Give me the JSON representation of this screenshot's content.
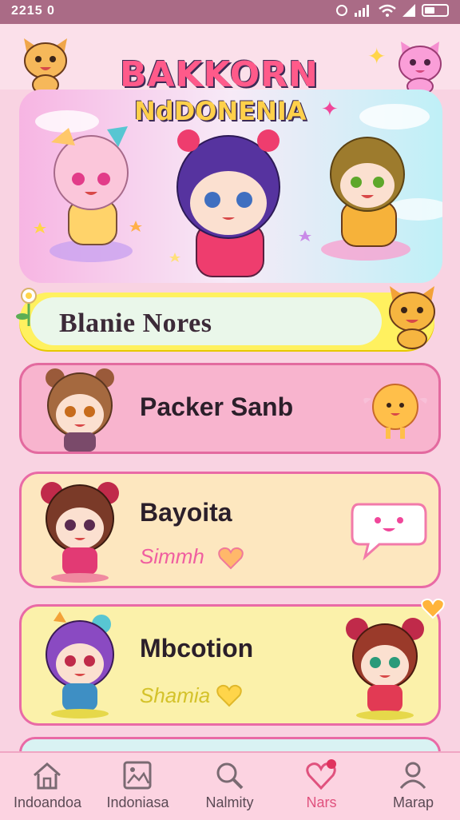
{
  "status_bar": {
    "time": "2215 0"
  },
  "header": {
    "logo_line1": "BAKKORN",
    "logo_line2": "NdDONENIA"
  },
  "banner": {
    "label": "Blanie Nores"
  },
  "cards": [
    {
      "title": "Packer Sanb",
      "subtitle": ""
    },
    {
      "title": "Bayoita",
      "subtitle": "Simmh"
    },
    {
      "title": "Mbcotion",
      "subtitle": "Shamia"
    }
  ],
  "nav": [
    {
      "label": "Indoandoa",
      "icon": "home-icon"
    },
    {
      "label": "Indoniasa",
      "icon": "gallery-icon"
    },
    {
      "label": "Nalmity",
      "icon": "search-icon"
    },
    {
      "label": "Nars",
      "icon": "heart-icon"
    },
    {
      "label": "Marap",
      "icon": "profile-icon"
    }
  ],
  "colors": {
    "status_bar": "#aa6b86",
    "accent": "#e96aa6",
    "banner": "#fff15f",
    "active_nav": "#e0527e"
  }
}
